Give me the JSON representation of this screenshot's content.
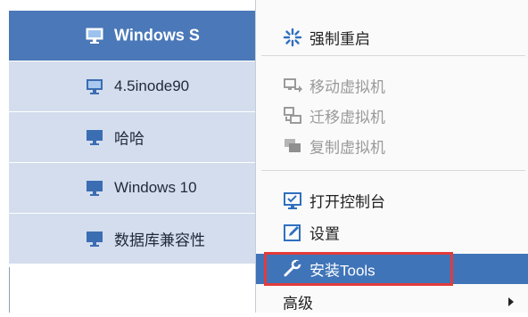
{
  "vm_list": {
    "items": [
      {
        "label": "Windows S",
        "selected": true
      },
      {
        "label": "4.5inode90",
        "selected": false
      },
      {
        "label": "哈哈",
        "selected": false
      },
      {
        "label": "Windows 10",
        "selected": false
      },
      {
        "label": "数据库兼容性",
        "selected": false
      }
    ]
  },
  "context_menu": {
    "items": [
      {
        "label": "强制重启",
        "icon": "force-restart-icon",
        "enabled": true
      },
      {
        "label": "移动虚拟机",
        "icon": "move-vm-icon",
        "enabled": false
      },
      {
        "label": "迁移虚拟机",
        "icon": "migrate-vm-icon",
        "enabled": false
      },
      {
        "label": "复制虚拟机",
        "icon": "copy-vm-icon",
        "enabled": false
      },
      {
        "label": "打开控制台",
        "icon": "console-icon",
        "enabled": true
      },
      {
        "label": "设置",
        "icon": "settings-icon",
        "enabled": true
      },
      {
        "label": "安装Tools",
        "icon": "wrench-icon",
        "enabled": true,
        "highlighted": true
      },
      {
        "label": "高级",
        "icon": "",
        "enabled": true,
        "has_submenu": true
      }
    ]
  },
  "colors": {
    "selected_row": "#4a78b8",
    "row_background": "#d3dded",
    "menu_highlight": "#3f74b8",
    "annotation_box": "#e23b3b"
  }
}
